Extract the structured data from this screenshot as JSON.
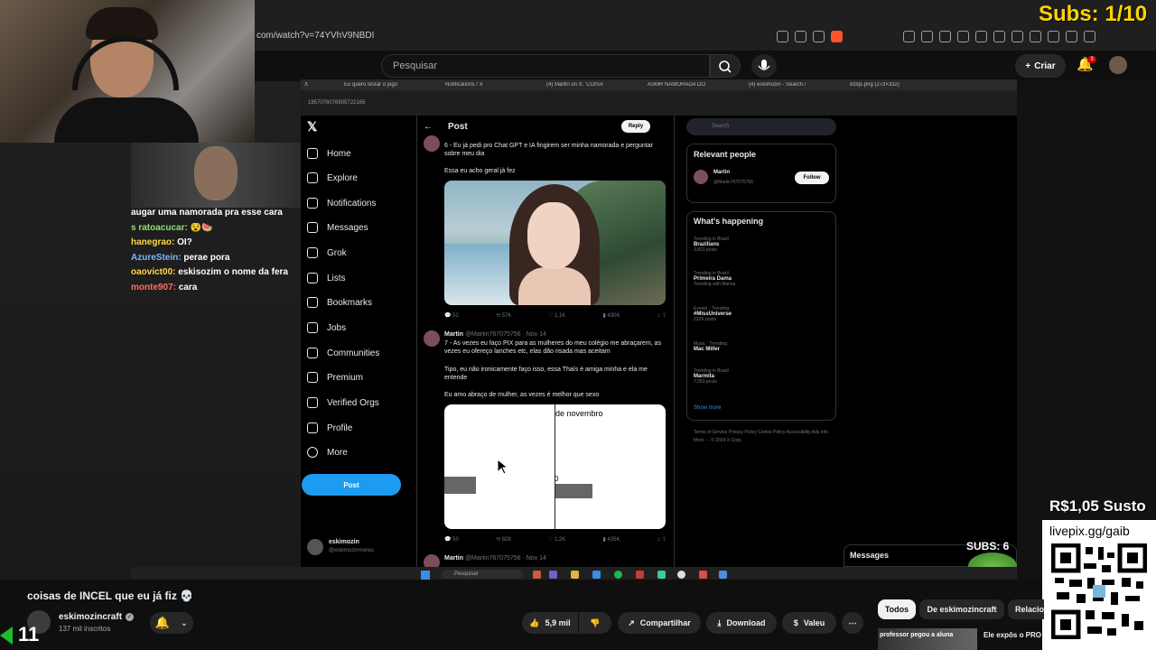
{
  "browser": {
    "url": "com/watch?v=74YVhV9NBDI",
    "subs_counter": "Subs: 1/10"
  },
  "youtube_header": {
    "search_placeholder": "Pesquisar",
    "create_label": "Criar",
    "notification_count": "3"
  },
  "stream": {
    "chat": [
      {
        "name": "",
        "text": "augar uma namorada pra esse cara",
        "color": "#ffffff"
      },
      {
        "name": "s ratoacucar:",
        "text": "",
        "color": "#8ee07a"
      },
      {
        "name": "hanegrao:",
        "text": "OI?",
        "color": "#ffd84a"
      },
      {
        "name": "AzureStein:",
        "text": "perae pora",
        "color": "#7ab7ff"
      },
      {
        "name": "oaovict00:",
        "text": "eskisozim o nome da fera",
        "color": "#ffd84a"
      },
      {
        "name": "monte907:",
        "text": "cara",
        "color": "#ff6b6b"
      }
    ],
    "inner_tabs": [
      "X",
      "Eu quero testar o jogo",
      "Notifications / X",
      "(4) Martin on X: 'COISA",
      "ASMR NAMORADA DO",
      "(4) eskimozin - Search /",
      "8zlqs.png (273×332)"
    ],
    "inner_url": "1857076076905722165",
    "x_nav": [
      {
        "icon": "home-icon",
        "label": "Home"
      },
      {
        "icon": "search-icon",
        "label": "Explore"
      },
      {
        "icon": "bell-icon",
        "label": "Notifications"
      },
      {
        "icon": "mail-icon",
        "label": "Messages"
      },
      {
        "icon": "grok-icon",
        "label": "Grok"
      },
      {
        "icon": "list-icon",
        "label": "Lists"
      },
      {
        "icon": "bookmark-icon",
        "label": "Bookmarks"
      },
      {
        "icon": "briefcase-icon",
        "label": "Jobs"
      },
      {
        "icon": "people-icon",
        "label": "Communities"
      },
      {
        "icon": "x-icon",
        "label": "Premium"
      },
      {
        "icon": "lightning-icon",
        "label": "Verified Orgs"
      },
      {
        "icon": "person-icon",
        "label": "Profile"
      },
      {
        "icon": "more-icon",
        "label": "More"
      }
    ],
    "x_post_button": "Post",
    "x_user": {
      "name": "eskimozin",
      "handle": "@eskimozinmoreu"
    },
    "post_header": {
      "title": "Post",
      "reply": "Reply"
    },
    "tweet1": {
      "text1": "6 - Eu já pedi pro Chat GPT e IA fingirem ser minha namorada e perguntar sobre meu dia",
      "text2": "Essa eu acho geral já fez",
      "actions": [
        "52",
        "576",
        "1,1K",
        "430K"
      ]
    },
    "tweet2": {
      "author": "Martin",
      "meta": "@Martin767075756 · Nov 14",
      "text1": "7 - As vezes eu faço PIX para as mulheres do meu colégio me abraçarem, as vezes eu ofereço lanches etc, elas dão risada mas aceitam",
      "text2": "Tipo, eu não ironicamente faço isso, essa Thaís é amiga minha e ela me entende",
      "text3": "Eu amo abraço de mulher, as vezes é melhor que sexo",
      "image_label": "de novembro",
      "image_zero": "0",
      "actions": [
        "50",
        "828",
        "1,2K",
        "435K"
      ]
    },
    "tweet3": {
      "author": "Martin",
      "meta": "@Martin767075756 · Nov 14"
    },
    "right_col": {
      "search": "Search",
      "relevant_title": "Relevant people",
      "relevant_name": "Martin",
      "relevant_handle": "@Martin767075756",
      "follow": "Follow",
      "happening_title": "What's happening",
      "trends": [
        {
          "context": "Trending in Brazil",
          "name": "Brazilians",
          "count": "3,801 posts"
        },
        {
          "context": "Trending in Brazil",
          "name": "Primeira Dama",
          "count": "Trending with Marisa"
        },
        {
          "context": "Events · Trending",
          "name": "#MissUniverse",
          "count": "232K posts"
        },
        {
          "context": "Music · Trending",
          "name": "Mac Miller",
          "count": ""
        },
        {
          "context": "Trending in Brazil",
          "name": "Marmita",
          "count": "7,053 posts"
        }
      ],
      "show_more": "Show more",
      "footer": "Terms of Service  Privacy Policy  Cookie Policy  Accessibility  Ads info  More ···  © 2024 X Corp."
    },
    "messages": "Messages",
    "subs_mid": "SUBS: 6",
    "taskbar_search": "Pesquisar",
    "susto": "R$1,05 Susto",
    "qr_url": "livepix.gg/gaib"
  },
  "video": {
    "title": "coisas de INCEL que eu já fiz 💀",
    "channel": "eskimozincraft",
    "subscribers": "137 mil inscritos",
    "likes": "5,9 mil",
    "share": "Compartilhar",
    "download": "Download",
    "thanks": "Valeu",
    "overlay_number": "11"
  },
  "recommendations": {
    "chips": [
      "Todos",
      "De eskimozincraft",
      "Relacio"
    ],
    "thumb_text": "professor pegou a aluna",
    "title": "Ele expôs o PRO TRAIU a ESPOSA"
  }
}
